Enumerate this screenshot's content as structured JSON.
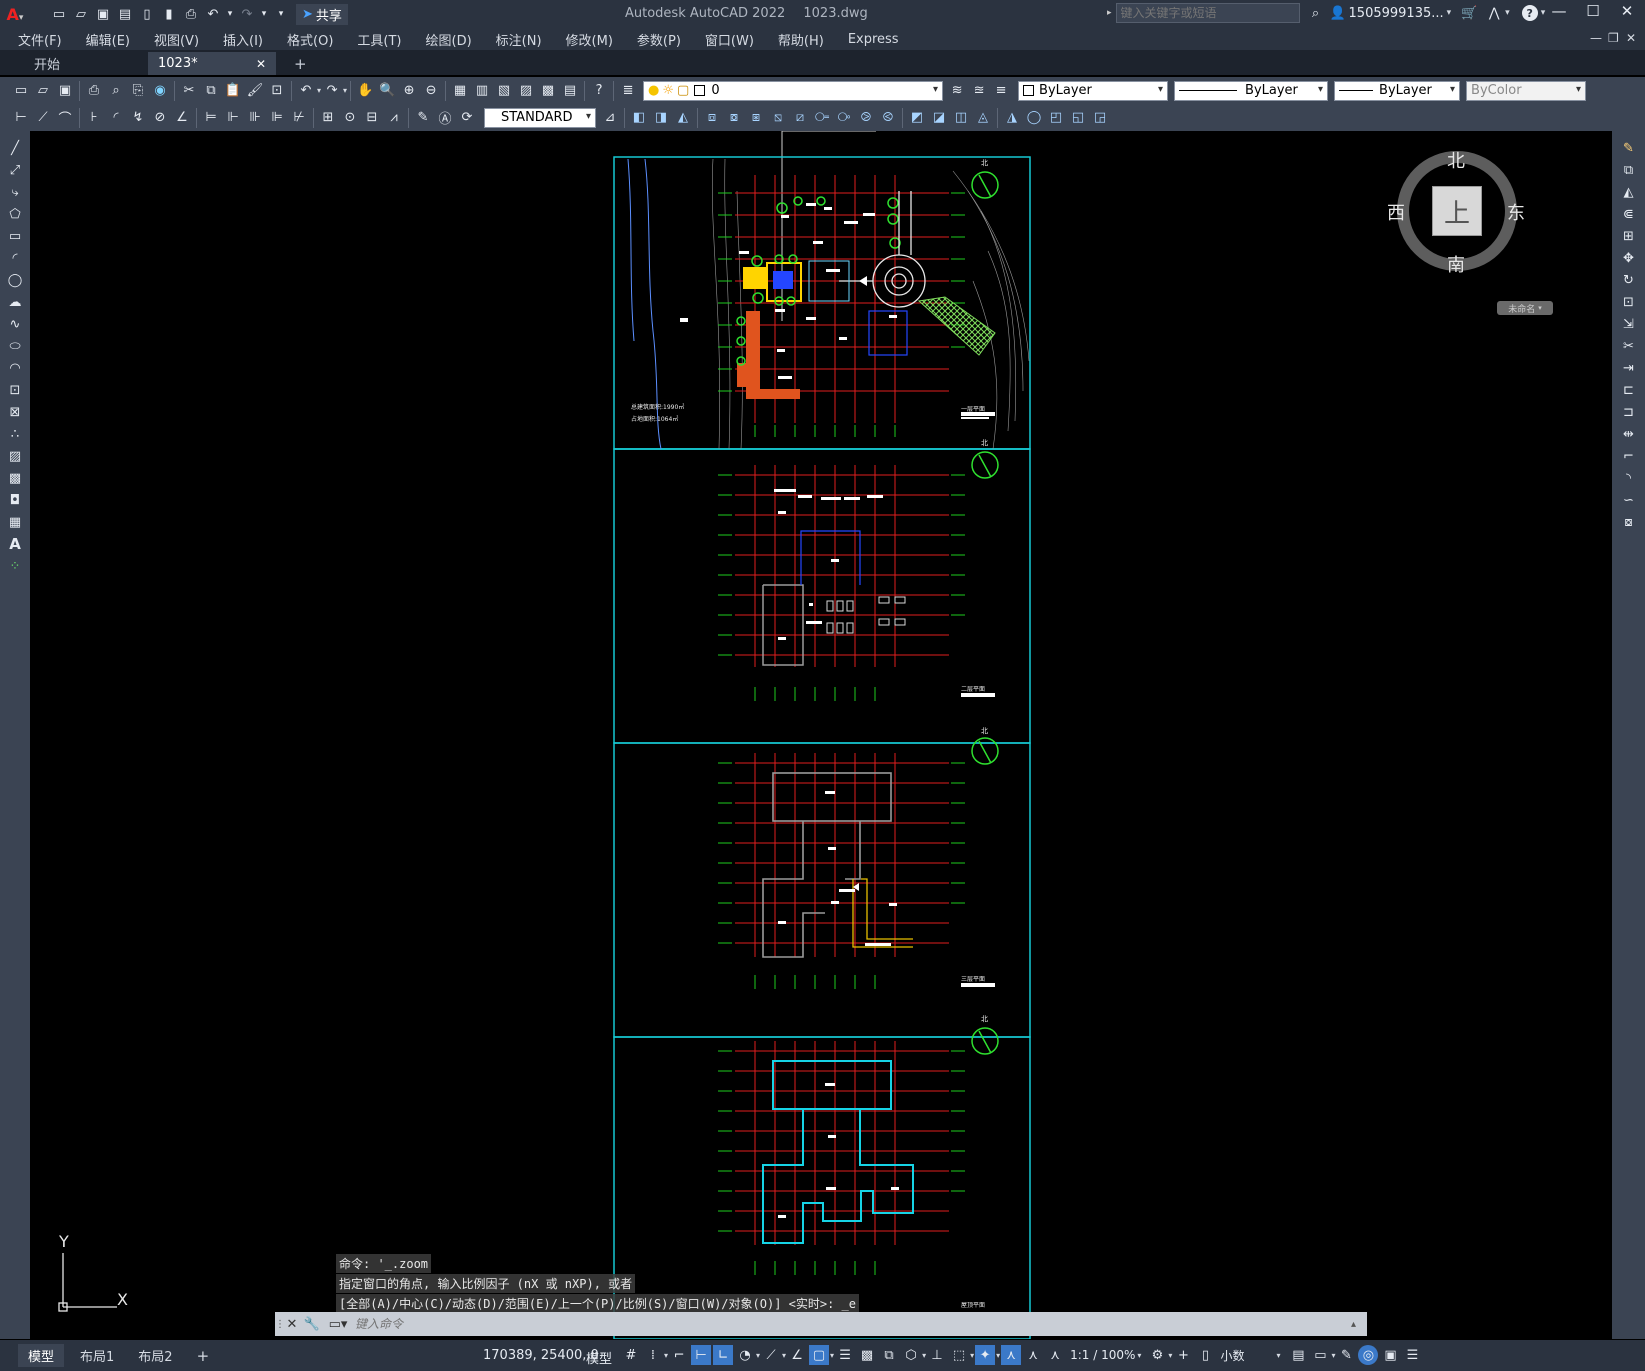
{
  "app": {
    "title": "Autodesk AutoCAD 2022",
    "filename": "1023.dwg",
    "share_label": "共享",
    "search_placeholder": "键入关键字或短语",
    "user": "1505999135...",
    "accent": "#00c8c8"
  },
  "menu": [
    "文件(F)",
    "编辑(E)",
    "视图(V)",
    "插入(I)",
    "格式(O)",
    "工具(T)",
    "绘图(D)",
    "标注(N)",
    "修改(M)",
    "参数(P)",
    "窗口(W)",
    "帮助(H)",
    "Express"
  ],
  "tabs": {
    "start": "开始",
    "active": "1023*",
    "add": "+"
  },
  "toolbar": {
    "layer_value": "0",
    "color": "ByLayer",
    "linetype": "ByLayer",
    "lineweight": "ByLayer",
    "plotstyle": "ByColor",
    "textstyle": "STANDARD"
  },
  "viewcube": {
    "north": "北",
    "south": "南",
    "east": "东",
    "west": "西",
    "top": "上",
    "wcs": "未命名"
  },
  "ucs": {
    "x": "X",
    "y": "Y"
  },
  "sheets": {
    "north": "北",
    "area1": "总建筑面积:1990㎡",
    "area2": "占地面积:1064㎡",
    "t1": "一层平面",
    "t2": "二层平面",
    "t3": "三层平面",
    "t4": "屋顶平面"
  },
  "command": {
    "h1": "命令: '_.zoom",
    "h2": "指定窗口的角点, 输入比例因子 (nX 或 nXP), 或者",
    "h3": "[全部(A)/中心(C)/动态(D)/范围(E)/上一个(P)/比例(S)/窗口(W)/对象(O)] <实时>: _e",
    "placeholder": "键入命令"
  },
  "status": {
    "model_tab": "模型",
    "layout1": "布局1",
    "layout2": "布局2",
    "add": "+",
    "coords": "170389, 25400, 0",
    "mode": "模型",
    "scale": "1:1 / 100%",
    "units": "小数"
  }
}
